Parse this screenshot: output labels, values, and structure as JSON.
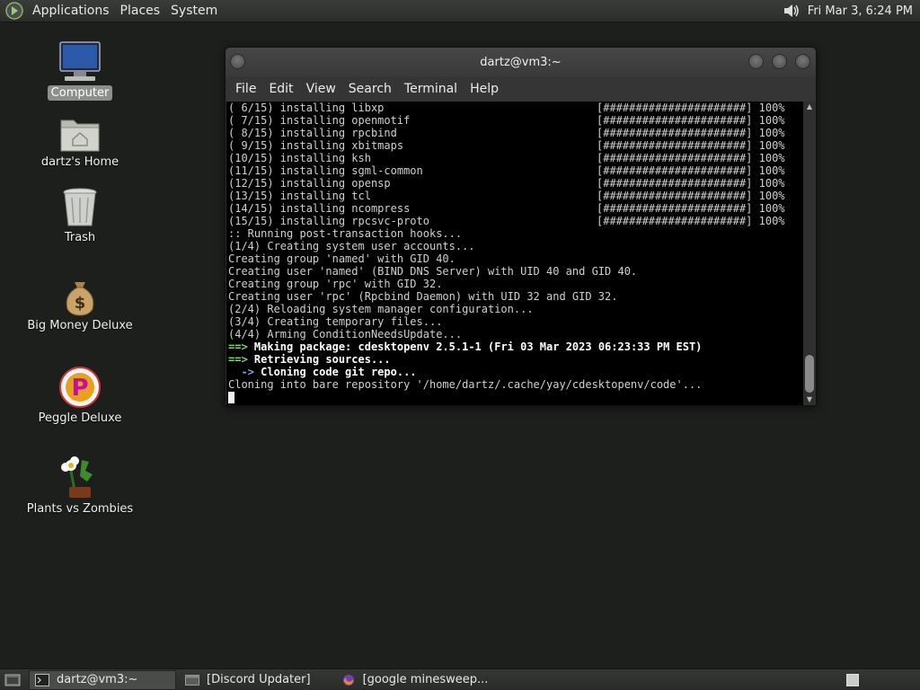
{
  "top_panel": {
    "menus": [
      "Applications",
      "Places",
      "System"
    ],
    "clock": "Fri Mar  3,  6:24 PM"
  },
  "desktop_icons": [
    {
      "label": "Computer",
      "icon": "computer-icon",
      "selected": true
    },
    {
      "label": "dartz's Home",
      "icon": "home-folder-icon"
    },
    {
      "label": "Trash",
      "icon": "trash-icon"
    },
    {
      "label": "Big Money Deluxe",
      "icon": "money-bag-icon"
    },
    {
      "label": "Peggle Deluxe",
      "icon": "peggle-icon"
    },
    {
      "label": "Plants vs Zombies",
      "icon": "plants-vs-zombies-icon"
    }
  ],
  "terminal": {
    "title": "dartz@vm3:~",
    "menu": [
      "File",
      "Edit",
      "View",
      "Search",
      "Terminal",
      "Help"
    ],
    "packages": [
      {
        "text": "( 6/15) installing libxp",
        "bar": "[######################] 100%"
      },
      {
        "text": "( 7/15) installing openmotif",
        "bar": "[######################] 100%"
      },
      {
        "text": "( 8/15) installing rpcbind",
        "bar": "[######################] 100%"
      },
      {
        "text": "( 9/15) installing xbitmaps",
        "bar": "[######################] 100%"
      },
      {
        "text": "(10/15) installing ksh",
        "bar": "[######################] 100%"
      },
      {
        "text": "(11/15) installing sgml-common",
        "bar": "[######################] 100%"
      },
      {
        "text": "(12/15) installing opensp",
        "bar": "[######################] 100%"
      },
      {
        "text": "(13/15) installing tcl",
        "bar": "[######################] 100%"
      },
      {
        "text": "(14/15) installing ncompress",
        "bar": "[######################] 100%"
      },
      {
        "text": "(15/15) installing rpcsvc-proto",
        "bar": "[######################] 100%"
      }
    ],
    "lines": [
      ":: Running post-transaction hooks...",
      "(1/4) Creating system user accounts...",
      "Creating group 'named' with GID 40.",
      "Creating user 'named' (BIND DNS Server) with UID 40 and GID 40.",
      "Creating group 'rpc' with GID 32.",
      "Creating user 'rpc' (Rpcbind Daemon) with UID 32 and GID 32.",
      "(2/4) Reloading system manager configuration...",
      "(3/4) Creating temporary files...",
      "(4/4) Arming ConditionNeedsUpdate..."
    ],
    "make_arrow": "==>",
    "make_text": " Making package: cdesktopenv 2.5.1-1 (Fri 03 Mar 2023 06:23:33 PM EST)",
    "retrieve_arrow": "==>",
    "retrieve_text": " Retrieving sources...",
    "clone_arrow": "  ->",
    "clone_text": " Cloning code git repo...",
    "clone_line": "Cloning into bare repository '/home/dartz/.cache/yay/cdesktopenv/code'..."
  },
  "taskbar": {
    "tasks": [
      {
        "label": "dartz@vm3:~",
        "active": true,
        "icon": "terminal-icon"
      },
      {
        "label": "[Discord Updater]",
        "active": false,
        "icon": "window-icon"
      },
      {
        "label": "[google minesweep...",
        "active": false,
        "icon": "firefox-icon"
      }
    ]
  },
  "colors": {
    "desktop_bg": "#1d1f1d",
    "prompt_arrow_green": "#78d96a",
    "prompt_arrow_blue": "#7ea8e8"
  }
}
